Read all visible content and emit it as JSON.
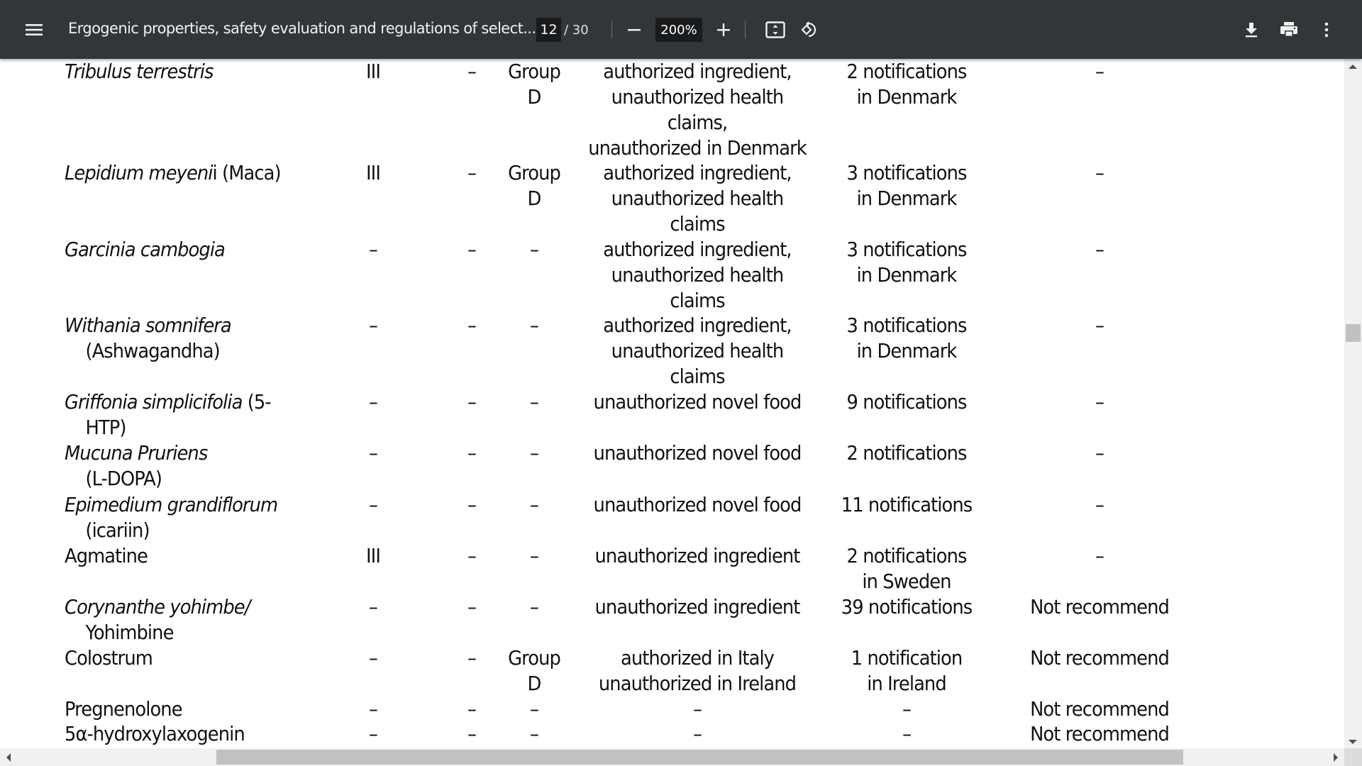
{
  "toolbar": {
    "title": "Ergogenic properties, safety evaluation and regulations of select...",
    "current_page": "12",
    "page_total": "/ 30",
    "zoom_level": "200%",
    "icons": {
      "menu": "hamburger-menu-icon",
      "zoom_out": "minus-icon",
      "zoom_in": "plus-icon",
      "fit": "fit-to-page-icon",
      "rotate": "rotate-counterclockwise-icon",
      "download": "download-icon",
      "print": "print-icon",
      "more": "more-vertical-icon"
    }
  },
  "table": {
    "rows": [
      {
        "name_italic": "Tribulus terrestris",
        "name_plain": "",
        "name_line2": "",
        "c2": "III",
        "c3": "–",
        "c4": [
          "Group",
          "D"
        ],
        "c5": [
          "authorized ingredient,",
          "unauthorized health",
          "claims,",
          "unauthorized in Denmark"
        ],
        "c6": [
          "2 notifications",
          "in Denmark"
        ],
        "c7": "–"
      },
      {
        "name_italic": "Lepidium meyeni",
        "name_plain": "i (Maca)",
        "name_line2": "",
        "c2": "III",
        "c3": "–",
        "c4": [
          "Group",
          "D"
        ],
        "c5": [
          "authorized ingredient,",
          "unauthorized health",
          "claims"
        ],
        "c6": [
          "3 notifications",
          "in Denmark"
        ],
        "c7": "–"
      },
      {
        "name_italic": "Garcinia cambogia",
        "name_plain": "",
        "name_line2": "",
        "c2": "–",
        "c3": "–",
        "c4": [
          "–"
        ],
        "c5": [
          "authorized ingredient,",
          "unauthorized health",
          "claims"
        ],
        "c6": [
          "3 notifications",
          "in Denmark"
        ],
        "c7": "–"
      },
      {
        "name_italic": "Withania somnifera",
        "name_plain": "",
        "name_line2": "(Ashwagandha)",
        "c2": "–",
        "c3": "–",
        "c4": [
          "–"
        ],
        "c5": [
          "authorized ingredient,",
          "unauthorized health",
          "claims"
        ],
        "c6": [
          "3 notifications",
          "in Denmark"
        ],
        "c7": "–"
      },
      {
        "name_italic": "Griffonia simplicifolia",
        "name_plain": " (5-",
        "name_line2": "HTP)",
        "c2": "–",
        "c3": "–",
        "c4": [
          "–"
        ],
        "c5": [
          "unauthorized novel food"
        ],
        "c6": [
          "9 notifications"
        ],
        "c7": "–"
      },
      {
        "name_italic": "Mucuna Pruriens",
        "name_plain": "",
        "name_line2": "(L-DOPA)",
        "c2": "–",
        "c3": "–",
        "c4": [
          "–"
        ],
        "c5": [
          "unauthorized novel food"
        ],
        "c6": [
          "2 notifications"
        ],
        "c7": "–"
      },
      {
        "name_italic": "Epimedium grandiflorum",
        "name_plain": "",
        "name_line2": "(icariin)",
        "c2": "–",
        "c3": "–",
        "c4": [
          "–"
        ],
        "c5": [
          "unauthorized novel food"
        ],
        "c6": [
          "11 notifications"
        ],
        "c7": "–"
      },
      {
        "name_italic": "",
        "name_plain": "Agmatine",
        "name_line2": "",
        "c2": "III",
        "c3": "–",
        "c4": [
          "–"
        ],
        "c5": [
          "unauthorized ingredient"
        ],
        "c6": [
          "2 notifications",
          "in Sweden"
        ],
        "c7": "–"
      },
      {
        "name_italic": "Corynanthe yohimbe/",
        "name_plain": "",
        "name_line2": "Yohimbine",
        "c2": "–",
        "c3": "–",
        "c4": [
          "–"
        ],
        "c5": [
          "unauthorized ingredient"
        ],
        "c6": [
          "39 notifications"
        ],
        "c7": "Not recommend"
      },
      {
        "name_italic": "",
        "name_plain": "Colostrum",
        "name_line2": "",
        "c2": "–",
        "c3": "–",
        "c4": [
          "Group",
          "D"
        ],
        "c5": [
          "authorized in Italy",
          "unauthorized in Ireland"
        ],
        "c6": [
          "1 notification",
          "in Ireland"
        ],
        "c7": "Not recommend"
      },
      {
        "name_italic": "",
        "name_plain": "Pregnenolone",
        "name_line2": "",
        "c2": "–",
        "c3": "–",
        "c4": [
          "–"
        ],
        "c5": [
          "–"
        ],
        "c6": [
          "–"
        ],
        "c7": "Not recommend"
      },
      {
        "name_italic": "",
        "name_plain": "5α-hydroxylaxogenin",
        "name_line2": "",
        "c2": "–",
        "c3": "–",
        "c4": [
          "–"
        ],
        "c5": [
          "–"
        ],
        "c6": [
          "–"
        ],
        "c7": "Not recommend"
      }
    ]
  }
}
